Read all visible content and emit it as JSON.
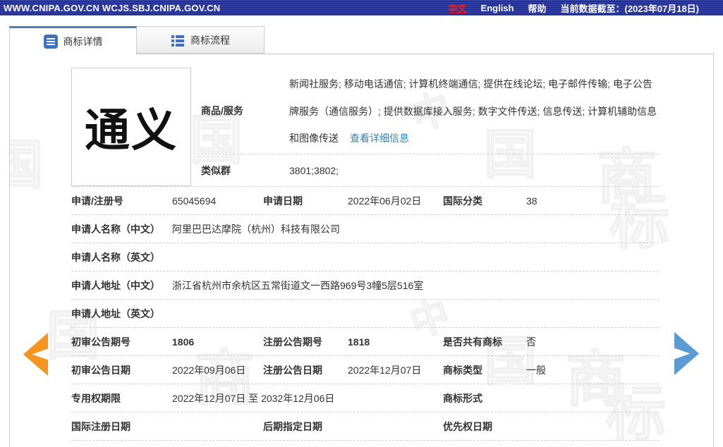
{
  "topbar": {
    "urls": "WWW.CNIPA.GOV.CN WCJS.SBJ.CNIPA.GOV.CN",
    "lang_zh": "中文",
    "lang_en": "English",
    "help": "帮助",
    "data_cutoff": "当前数据截至：(2023年07月18日)"
  },
  "tabs": [
    {
      "label": "商标详情"
    },
    {
      "label": "商标流程"
    }
  ],
  "trademark": {
    "image_text": "通义"
  },
  "goods": {
    "label": "商品/服务",
    "line1": "新闻社服务; 移动电话通信; 计算机终端通信; 提供在线论坛; 电子邮件传输; 电子公告",
    "line2": "牌服务（通信服务）; 提供数据库接入服务; 数字文件传送; 信息传送; 计算机辅助信息",
    "line3": "和图像传送",
    "detail_link": "查看详细信息"
  },
  "similar_group": {
    "label": "类似群",
    "value": "3801;3802;"
  },
  "table": {
    "row1": {
      "l1": "申请/注册号",
      "v1": "65045694",
      "l2": "申请日期",
      "v2": "2022年06月02日",
      "l3": "国际分类",
      "v3": "38"
    },
    "row2": {
      "l1": "申请人名称（中文）",
      "v1": "阿里巴巴达摩院（杭州）科技有限公司"
    },
    "row3": {
      "l1": "申请人名称（英文）",
      "v1": ""
    },
    "row4": {
      "l1": "申请人地址（中文）",
      "v1": "浙江省杭州市余杭区五常街道文一西路969号3幢5层516室"
    },
    "row5": {
      "l1": "申请人地址（英文）",
      "v1": ""
    },
    "row6": {
      "l1": "初审公告期号",
      "v1": "1806",
      "l2": "注册公告期号",
      "v2": "1818",
      "l3": "是否共有商标",
      "v3": "否"
    },
    "row7": {
      "l1": "初审公告日期",
      "v1": "2022年09月06日",
      "l2": "注册公告日期",
      "v2": "2022年12月07日",
      "l3": "商标类型",
      "v3": "一般"
    },
    "row8": {
      "l1": "专用权期限",
      "v1": "2022年12月07日 至 2032年12月06日",
      "l3": "商标形式",
      "v3": ""
    },
    "row9": {
      "l1": "国际注册日期",
      "l2": "后期指定日期",
      "l3": "优先权日期"
    }
  },
  "watermark": {
    "c0": "中",
    "c1": "国",
    "c2": "商",
    "c3": "标"
  },
  "colors": {
    "topbar_blue": "#1e2c96",
    "tab_accent": "#4f7cc0",
    "link_blue": "#2f84c7",
    "arrow_orange": "#f7941d",
    "arrow_blue": "#5b9bd5",
    "lang_red": "#ff1a1a"
  }
}
